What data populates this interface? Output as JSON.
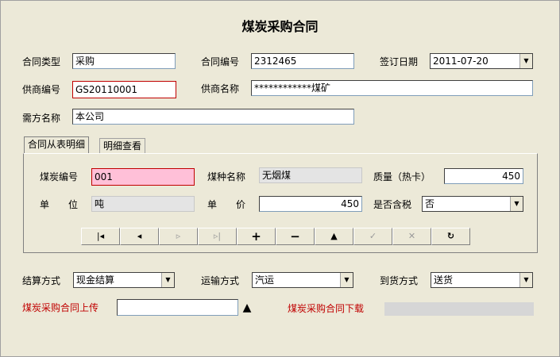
{
  "title": "煤炭采购合同",
  "form": {
    "contract_type": {
      "label": "合同类型",
      "value": "采购"
    },
    "contract_no": {
      "label": "合同编号",
      "value": "2312465"
    },
    "sign_date": {
      "label": "签订日期",
      "value": "2011-07-20"
    },
    "supplier_no": {
      "label": "供商编号",
      "value": "GS20110001"
    },
    "supplier_name": {
      "label": "供商名称",
      "value": "************煤矿"
    },
    "buyer_name": {
      "label": "需方名称",
      "value": "本公司"
    }
  },
  "tabs": [
    {
      "label": "合同从表明细"
    },
    {
      "label": "明细查看"
    }
  ],
  "detail": {
    "coal_no": {
      "label": "煤炭编号",
      "value": "001"
    },
    "coal_type": {
      "label": "煤种名称",
      "value": "无烟煤"
    },
    "quality": {
      "label": "质量（热卡）",
      "value": "450"
    },
    "unit": {
      "label": "单　　位",
      "value": "吨"
    },
    "price": {
      "label": "单　　价",
      "value": "450"
    },
    "tax": {
      "label": "是否含税",
      "value": "否"
    }
  },
  "nav_buttons": [
    {
      "icon": "first-icon",
      "glyph": "|◂"
    },
    {
      "icon": "prev-icon",
      "glyph": "◂"
    },
    {
      "icon": "next-icon",
      "glyph": "▹"
    },
    {
      "icon": "last-icon",
      "glyph": "▹|"
    },
    {
      "icon": "add-icon",
      "glyph": "+"
    },
    {
      "icon": "delete-icon",
      "glyph": "−"
    },
    {
      "icon": "edit-icon",
      "glyph": "▲"
    },
    {
      "icon": "post-icon",
      "glyph": "✓"
    },
    {
      "icon": "cancel-icon",
      "glyph": "✕"
    },
    {
      "icon": "refresh-icon",
      "glyph": "↻"
    }
  ],
  "settlement": {
    "label": "结算方式",
    "value": "现金结算"
  },
  "transport": {
    "label": "运输方式",
    "value": "汽运"
  },
  "delivery": {
    "label": "到货方式",
    "value": "送货"
  },
  "upload": {
    "label": "煤炭采购合同上传",
    "value": ""
  },
  "download": {
    "label": "煤炭采购合同下载"
  },
  "colors": {
    "required_border": "#c00000",
    "highlight_field": "#ffc0d8",
    "link_red": "#c00000"
  }
}
